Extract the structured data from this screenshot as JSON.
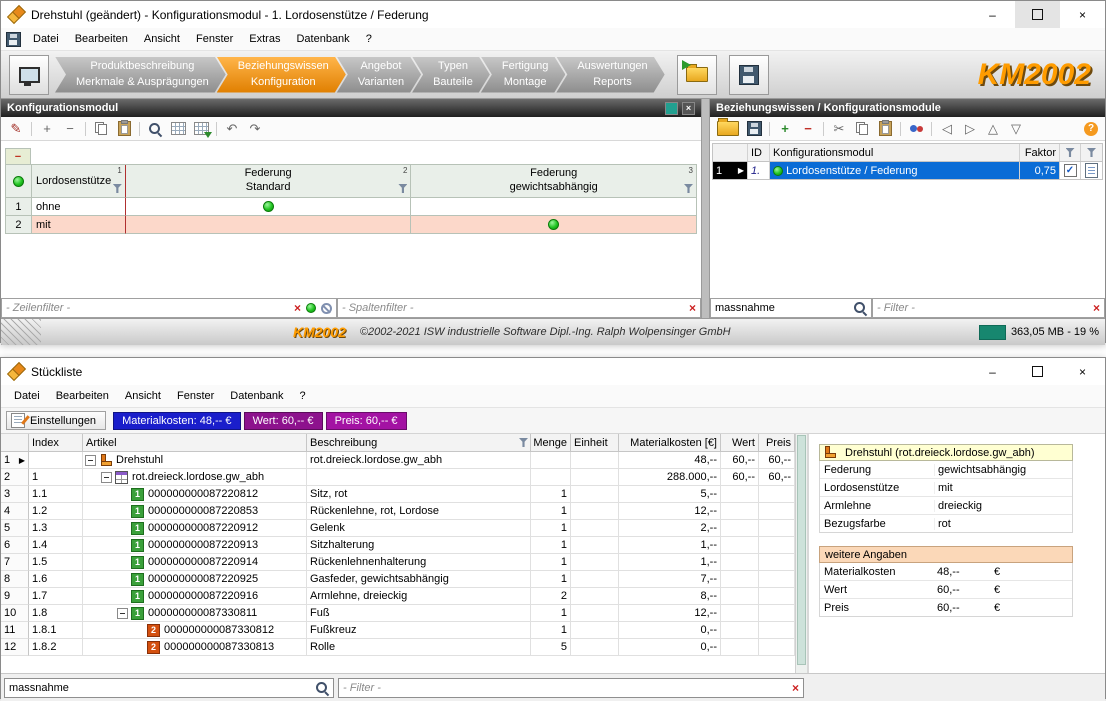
{
  "icons": {
    "plus": "+",
    "minus": "−",
    "cut": "✂",
    "pencil": "✎",
    "undo": "↶",
    "redo": "↷",
    "help": "?",
    "close_small": "×",
    "check": "✓",
    "marker": "▶",
    "nav_left": "◁",
    "nav_right": "▷",
    "nav_up": "△",
    "nav_down": "▽",
    "minimize": "–",
    "close": "×"
  },
  "window1": {
    "title": "Drehstuhl (geändert) - Konfigurationsmodul - 1. Lordosenstütze / Federung",
    "menu": [
      "Datei",
      "Bearbeiten",
      "Ansicht",
      "Fenster",
      "Extras",
      "Datenbank",
      "?"
    ],
    "brand": "KM2002",
    "tabs": [
      {
        "line1": "Produktbeschreibung",
        "line2": "Merkmale & Ausprägungen"
      },
      {
        "line1": "Beziehungswissen",
        "line2": "Konfiguration"
      },
      {
        "line1": "Angebot",
        "line2": "Varianten"
      },
      {
        "line1": "Typen",
        "line2": "Bauteile"
      },
      {
        "line1": "Fertigung",
        "line2": "Montage"
      },
      {
        "line1": "Auswertungen",
        "line2": "Reports"
      }
    ],
    "left": {
      "title": "Konfigurationsmodul",
      "matrix": {
        "corner": "−",
        "row_header": {
          "label": "Lordosenstütze",
          "sup": "1"
        },
        "col_headers": [
          {
            "line1": "Federung",
            "line2": "Standard",
            "sup": "2"
          },
          {
            "line1": "Federung",
            "line2": "gewichtsabhängig",
            "sup": "3"
          }
        ],
        "rows": [
          {
            "num": "1",
            "label": "ohne"
          },
          {
            "num": "2",
            "label": "mit"
          }
        ]
      },
      "zeilenfilter_placeholder": "- Zeilenfilter -",
      "spaltenfilter_placeholder": "- Spaltenfilter -"
    },
    "right": {
      "title": "Beziehungswissen / Konfigurationsmodule",
      "columns": {
        "id": "ID",
        "modul": "Konfigurationsmodul",
        "faktor": "Faktor"
      },
      "row": {
        "num": "1",
        "id": "1.",
        "name": "Lordosenstütze / Federung",
        "faktor": "0,75"
      },
      "search_value": "massnahme",
      "filter_placeholder": "- Filter -"
    },
    "status": {
      "brand": "KM2002",
      "copyright": "©2002-2021 ISW industrielle Software Dipl.-Ing. Ralph Wolpensinger GmbH",
      "memory": "363,05 MB - 19 %"
    }
  },
  "window2": {
    "title": "Stückliste",
    "menu": [
      "Datei",
      "Bearbeiten",
      "Ansicht",
      "Fenster",
      "Datenbank",
      "?"
    ],
    "toolbar": {
      "settings_label": "Einstellungen",
      "badges": [
        {
          "label": "Materialkosten: 48,-- €",
          "color": "#1a1ecb"
        },
        {
          "label": "Wert: 60,-- €",
          "color": "#8d128d"
        },
        {
          "label": "Preis: 60,-- €",
          "color": "#a312a3"
        }
      ]
    },
    "table": {
      "columns": [
        "Index",
        "Artikel",
        "Beschreibung",
        "Menge",
        "Einheit",
        "Materialkosten [€]",
        "Wert",
        "Preis"
      ],
      "rows": [
        {
          "n": "1",
          "idx": "",
          "art": "Drehstuhl",
          "icon": "chair",
          "ic_txt": "",
          "lvl": 0,
          "exp": true,
          "marker": true,
          "beschr": "rot.dreieck.lordose.gw_abh",
          "menge": "",
          "einheit": "",
          "mk": "48,--",
          "wert": "60,--",
          "preis": "60,--"
        },
        {
          "n": "2",
          "idx": "1",
          "art": "rot.dreieck.lordose.gw_abh",
          "icon": "tbl",
          "ic_txt": "",
          "lvl": 1,
          "exp": true,
          "marker": false,
          "beschr": "",
          "menge": "",
          "einheit": "",
          "mk": "288.000,--",
          "wert": "60,--",
          "preis": "60,--"
        },
        {
          "n": "3",
          "idx": "1.1",
          "art": "000000000087220812",
          "icon": "g1",
          "ic_txt": "1",
          "lvl": 2,
          "exp": false,
          "marker": false,
          "beschr": "Sitz, rot",
          "menge": "1",
          "einheit": "",
          "mk": "5,--",
          "wert": "",
          "preis": ""
        },
        {
          "n": "4",
          "idx": "1.2",
          "art": "000000000087220853",
          "icon": "g1",
          "ic_txt": "1",
          "lvl": 2,
          "exp": false,
          "marker": false,
          "beschr": "Rückenlehne, rot, Lordose",
          "menge": "1",
          "einheit": "",
          "mk": "12,--",
          "wert": "",
          "preis": ""
        },
        {
          "n": "5",
          "idx": "1.3",
          "art": "000000000087220912",
          "icon": "g1",
          "ic_txt": "1",
          "lvl": 2,
          "exp": false,
          "marker": false,
          "beschr": "Gelenk",
          "menge": "1",
          "einheit": "",
          "mk": "2,--",
          "wert": "",
          "preis": ""
        },
        {
          "n": "6",
          "idx": "1.4",
          "art": "000000000087220913",
          "icon": "g1",
          "ic_txt": "1",
          "lvl": 2,
          "exp": false,
          "marker": false,
          "beschr": "Sitzhalterung",
          "menge": "1",
          "einheit": "",
          "mk": "1,--",
          "wert": "",
          "preis": ""
        },
        {
          "n": "7",
          "idx": "1.5",
          "art": "000000000087220914",
          "icon": "g1",
          "ic_txt": "1",
          "lvl": 2,
          "exp": false,
          "marker": false,
          "beschr": "Rückenlehnenhalterung",
          "menge": "1",
          "einheit": "",
          "mk": "1,--",
          "wert": "",
          "preis": ""
        },
        {
          "n": "8",
          "idx": "1.6",
          "art": "000000000087220925",
          "icon": "g1",
          "ic_txt": "1",
          "lvl": 2,
          "exp": false,
          "marker": false,
          "beschr": "Gasfeder, gewichtsabhängig",
          "menge": "1",
          "einheit": "",
          "mk": "7,--",
          "wert": "",
          "preis": ""
        },
        {
          "n": "9",
          "idx": "1.7",
          "art": "000000000087220916",
          "icon": "g1",
          "ic_txt": "1",
          "lvl": 2,
          "exp": false,
          "marker": false,
          "beschr": "Armlehne, dreieckig",
          "menge": "2",
          "einheit": "",
          "mk": "8,--",
          "wert": "",
          "preis": ""
        },
        {
          "n": "10",
          "idx": "1.8",
          "art": "000000000087330811",
          "icon": "g1",
          "ic_txt": "1",
          "lvl": 2,
          "exp": true,
          "marker": false,
          "beschr": "Fuß",
          "menge": "1",
          "einheit": "",
          "mk": "12,--",
          "wert": "",
          "preis": ""
        },
        {
          "n": "11",
          "idx": "1.8.1",
          "art": "000000000087330812",
          "icon": "r2",
          "ic_txt": "2",
          "lvl": 3,
          "exp": false,
          "marker": false,
          "beschr": "Fußkreuz",
          "menge": "1",
          "einheit": "",
          "mk": "0,--",
          "wert": "",
          "preis": ""
        },
        {
          "n": "12",
          "idx": "1.8.2",
          "art": "000000000087330813",
          "icon": "r2",
          "ic_txt": "2",
          "lvl": 3,
          "exp": false,
          "marker": false,
          "beschr": "Rolle",
          "menge": "5",
          "einheit": "",
          "mk": "0,--",
          "wert": "",
          "preis": ""
        }
      ]
    },
    "detail": {
      "title": "Drehstuhl (rot.dreieck.lordose.gw_abh)",
      "properties": [
        {
          "label": "Federung",
          "value": "gewichtsabhängig"
        },
        {
          "label": "Lordosenstütze",
          "value": "mit"
        },
        {
          "label": "Armlehne",
          "value": "dreieckig"
        },
        {
          "label": "Bezugsfarbe",
          "value": "rot"
        }
      ],
      "more_title": "weitere Angaben",
      "more": [
        {
          "label": "Materialkosten",
          "value": "48,--",
          "unit": "€"
        },
        {
          "label": "Wert",
          "value": "60,--",
          "unit": "€"
        },
        {
          "label": "Preis",
          "value": "60,--",
          "unit": "€"
        }
      ]
    },
    "footer": {
      "search_value": "massnahme",
      "filter_placeholder": "- Filter -"
    }
  }
}
